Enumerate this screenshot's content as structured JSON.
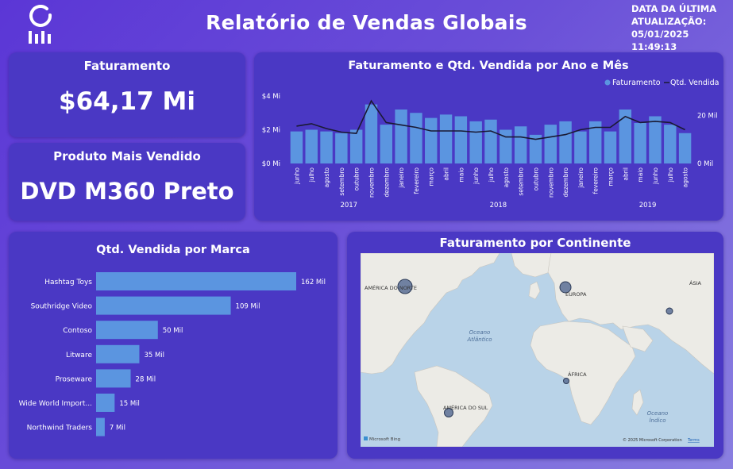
{
  "header": {
    "title": "Relatório de Vendas Globais",
    "update_line1": "DATA DA ÚLTIMA",
    "update_line2": "ATUALIZAÇÃO:",
    "update_line3": "05/01/2025 11:49:13",
    "logo_icon": "chart-logo-icon"
  },
  "kpi_revenue": {
    "title": "Faturamento",
    "value": "$64,17 Mi"
  },
  "kpi_product": {
    "title": "Produto Mais Vendido",
    "value": "DVD M360 Preto"
  },
  "colors": {
    "bar": "#5b95e0",
    "line": "#1a1a33",
    "card": "#4a38c4",
    "marker": "#5a6f94"
  },
  "chart_data": [
    {
      "type": "bar",
      "title": "Faturamento e Qtd. Vendida por Ano e Mês",
      "legend": "top-right",
      "y_left_ticks": [
        "$0 Mi",
        "$2 Mi",
        "$4 Mi"
      ],
      "y_right_ticks": [
        "0 Mil",
        "20 Mil"
      ],
      "ylim_left": [
        0,
        4
      ],
      "ylim_right": [
        0,
        28
      ],
      "years": [
        {
          "label": "2017",
          "first": 0,
          "last": 7
        },
        {
          "label": "2018",
          "first": 8,
          "last": 19
        },
        {
          "label": "2019",
          "first": 20,
          "last": 27
        }
      ],
      "categories": [
        "junho",
        "julho",
        "agosto",
        "setembro",
        "outubro",
        "novembro",
        "dezembro",
        "janeiro",
        "fevereiro",
        "março",
        "abril",
        "maio",
        "junho",
        "julho",
        "agosto",
        "setembro",
        "outubro",
        "novembro",
        "dezembro",
        "janeiro",
        "fevereiro",
        "março",
        "abril",
        "maio",
        "junho",
        "julho",
        "agosto"
      ],
      "series": [
        {
          "name": "Faturamento",
          "kind": "bar",
          "values": [
            1.9,
            2.0,
            1.9,
            1.8,
            2.0,
            3.5,
            2.3,
            3.2,
            3.0,
            2.7,
            2.9,
            2.8,
            2.5,
            2.6,
            2.0,
            2.2,
            1.7,
            2.3,
            2.5,
            1.9,
            2.5,
            1.9,
            3.2,
            2.4,
            2.8,
            2.3,
            1.8
          ]
        },
        {
          "name": "Qtd. Vendida",
          "kind": "line",
          "values": [
            15.5,
            16.5,
            14.5,
            13,
            12.5,
            26,
            17,
            16,
            15,
            13.5,
            13.5,
            13.5,
            13,
            13.5,
            11,
            11,
            10,
            11,
            12,
            14,
            15,
            15,
            19.5,
            17,
            17.5,
            17,
            14
          ]
        }
      ]
    },
    {
      "type": "bar",
      "orientation": "horizontal",
      "title": "Qtd. Vendida por Marca",
      "categories": [
        "Hashtag Toys",
        "Southridge Video",
        "Contoso",
        "Litware",
        "Proseware",
        "Wide World Import...",
        "Northwind Traders"
      ],
      "values": [
        162,
        109,
        50,
        35,
        28,
        15,
        7
      ],
      "data_labels": [
        "162 Mil",
        "109 Mil",
        "50 Mil",
        "35 Mil",
        "28 Mil",
        "15 Mil",
        "7 Mil"
      ]
    }
  ],
  "map": {
    "title": "Faturamento por Continente",
    "ocean_atlantic_line1": "Oceano",
    "ocean_atlantic_line2": "Atlântico",
    "ocean_indian_line1": "Oceano",
    "ocean_indian_line2": "Índico",
    "labels": {
      "north_america": "AMÉRICA DO NORTE",
      "europe": "EUROPA",
      "asia": "ÁSIA",
      "africa": "ÁFRICA",
      "south_america": "AMÉRICA DO SUL"
    },
    "bing": "Microsoft Bing",
    "copyright": "© 2025 Microsoft Corporation",
    "terms": "Terms"
  }
}
